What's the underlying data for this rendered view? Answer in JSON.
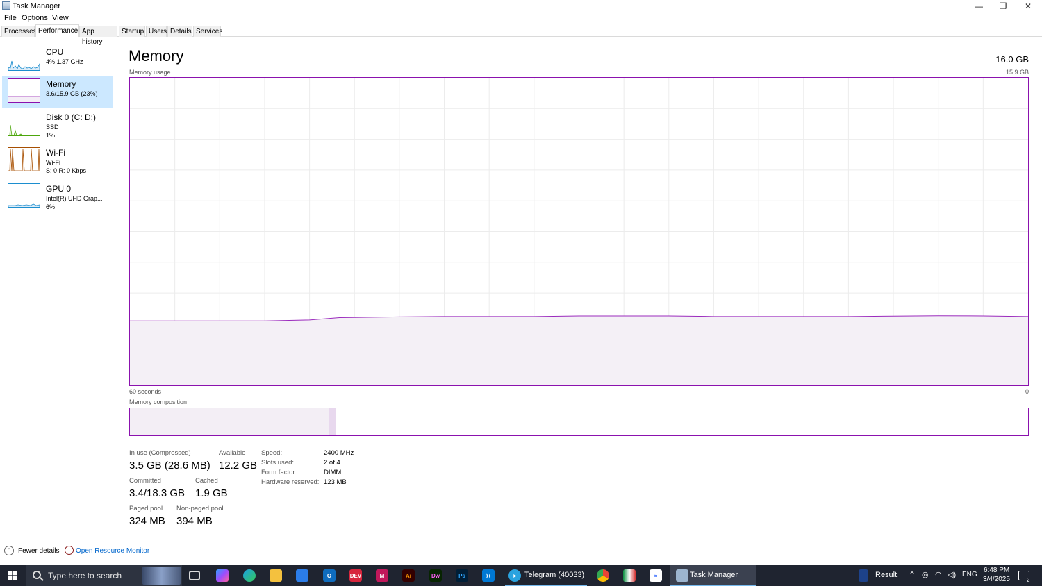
{
  "window": {
    "title": "Task Manager",
    "controls": {
      "minimize": "—",
      "maximize": "❐",
      "close": "✕"
    }
  },
  "menu": [
    "File",
    "Options",
    "View"
  ],
  "tabs": [
    "Processes",
    "Performance",
    "App history",
    "Startup",
    "Users",
    "Details",
    "Services"
  ],
  "active_tab": "Performance",
  "sidebar": {
    "items": [
      {
        "name": "CPU",
        "sub1": "4% 1.37 GHz",
        "sub2": "",
        "color": "#1c8ecf"
      },
      {
        "name": "Memory",
        "sub1": "3.6/15.9 GB (23%)",
        "sub2": "",
        "color": "#8b12ae"
      },
      {
        "name": "Disk 0 (C: D:)",
        "sub1": "SSD",
        "sub2": "1%",
        "color": "#4da60c"
      },
      {
        "name": "Wi-Fi",
        "sub1": "Wi-Fi",
        "sub2": "S: 0 R: 0 Kbps",
        "color": "#a74f01"
      },
      {
        "name": "GPU 0",
        "sub1": "Intel(R) UHD Grap...",
        "sub2": "6%",
        "color": "#1c8ecf"
      }
    ]
  },
  "main": {
    "title": "Memory",
    "total": "16.0 GB",
    "usage_label": "Memory usage",
    "usage_max": "15.9 GB",
    "time_left": "60 seconds",
    "time_right": "0",
    "composition_label": "Memory composition",
    "stats": {
      "in_use_label": "In use (Compressed)",
      "in_use_value": "3.5 GB (28.6 MB)",
      "available_label": "Available",
      "available_value": "12.2 GB",
      "committed_label": "Committed",
      "committed_value": "3.4/18.3 GB",
      "cached_label": "Cached",
      "cached_value": "1.9 GB",
      "paged_label": "Paged pool",
      "paged_value": "324 MB",
      "nonpaged_label": "Non-paged pool",
      "nonpaged_value": "394 MB"
    },
    "props": [
      {
        "label": "Speed:",
        "value": "2400 MHz"
      },
      {
        "label": "Slots used:",
        "value": "2 of 4"
      },
      {
        "label": "Form factor:",
        "value": "DIMM"
      },
      {
        "label": "Hardware reserved:",
        "value": "123 MB"
      }
    ]
  },
  "chart_data": {
    "type": "area",
    "ylabel": "Memory usage",
    "ylim": [
      0,
      15.9
    ],
    "x": [
      60,
      57,
      54,
      51,
      48,
      46,
      45,
      42,
      39,
      36,
      33,
      30,
      27,
      24,
      21,
      18,
      15,
      12,
      9,
      6,
      3,
      0
    ],
    "values": [
      3.33,
      3.33,
      3.33,
      3.33,
      3.38,
      3.5,
      3.51,
      3.54,
      3.56,
      3.56,
      3.56,
      3.59,
      3.59,
      3.59,
      3.56,
      3.56,
      3.56,
      3.56,
      3.58,
      3.6,
      3.59,
      3.56
    ]
  },
  "composition": {
    "in_use_frac": 0.222,
    "modified_frac": 0.008,
    "standby_frac": 0.108
  },
  "footer": {
    "fewer_details": "Fewer details",
    "resource_monitor": "Open Resource Monitor"
  },
  "taskbar": {
    "search_placeholder": "Type here to search",
    "apps": [
      {
        "name": "Telegram (40033)"
      },
      {
        "name": "Task Manager"
      }
    ],
    "tray": {
      "weather": "Result",
      "lang": "ENG",
      "time": "6:48 PM",
      "date": "3/4/2025",
      "notif_count": "2"
    }
  }
}
